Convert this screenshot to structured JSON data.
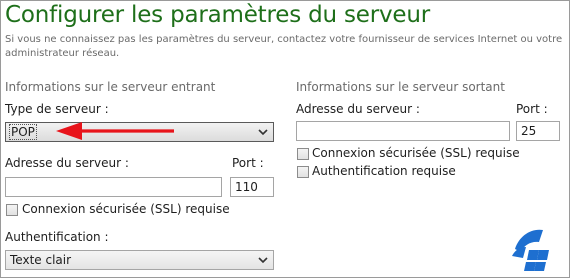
{
  "header": {
    "title": "Configurer les paramètres du serveur",
    "subtitle": "Si vous ne connaissez pas les paramètres du serveur, contactez votre fournisseur de services Internet ou votre administrateur réseau."
  },
  "incoming": {
    "section_title": "Informations sur le serveur entrant",
    "server_type_label": "Type de serveur :",
    "server_type_value": "POP",
    "address_label": "Adresse du serveur :",
    "address_value": "",
    "port_label": "Port :",
    "port_value": "110",
    "ssl_label": "Connexion sécurisée (SSL) requise",
    "ssl_checked": false,
    "auth_label": "Authentification :",
    "auth_value": "Texte clair"
  },
  "outgoing": {
    "section_title": "Informations sur le serveur sortant",
    "address_label": "Adresse du serveur :",
    "address_value": "",
    "port_label": "Port :",
    "port_value": "25",
    "ssl_label": "Connexion sécurisée (SSL) requise",
    "ssl_checked": false,
    "auth_label": "Authentification requise",
    "auth_checked": false
  },
  "annotation": {
    "arrow_color": "#e8141b"
  },
  "colors": {
    "title": "#1e6f1a",
    "muted_text": "#6a6a6a",
    "logo_blue": "#1e6fd0"
  },
  "icons": [
    "chevron-down-icon",
    "red-arrow-annotation",
    "windows-logo-icon"
  ]
}
